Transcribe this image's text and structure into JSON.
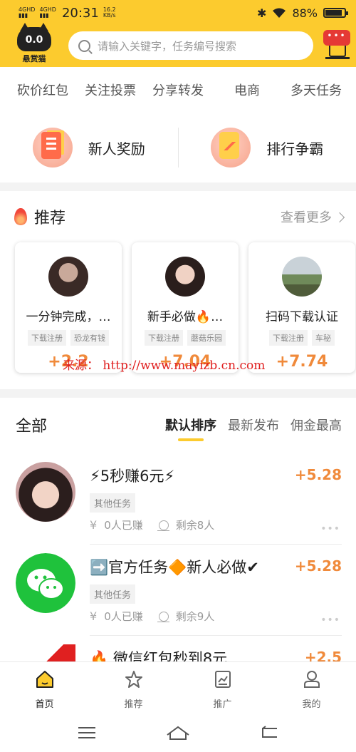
{
  "status": {
    "signal1": "4GHD",
    "signal2": "4GHD",
    "time": "20:31",
    "speed_value": "16.2",
    "speed_unit": "KB/s",
    "battery": "88%",
    "battery_level": 0.88
  },
  "header": {
    "logo_text": "悬赏猫",
    "logo_eyes": "0.0",
    "search_placeholder": "请输入关键字，任务编号搜索",
    "notif_dots": "•••"
  },
  "categories": [
    "砍价红包",
    "关注投票",
    "分享转发",
    "电商",
    "多天任务"
  ],
  "promo": [
    {
      "label": "新人奖励",
      "icon": "task-list-icon"
    },
    {
      "label": "排行争霸",
      "icon": "ranking-chart-icon"
    }
  ],
  "recommend": {
    "title": "推荐",
    "more": "查看更多",
    "cards": [
      {
        "title": "一分钟完成，…",
        "tags": [
          "下载注册",
          "恐龙有钱"
        ],
        "price": "+2.2"
      },
      {
        "title": "新手必做🔥…",
        "tags": [
          "下载注册",
          "蘑菇乐园"
        ],
        "price": "+7.04"
      },
      {
        "title": "扫码下载认证",
        "tags": [
          "下载注册",
          "车秘"
        ],
        "price": "+7.74"
      }
    ]
  },
  "watermark": "来源： http://www.mayizb.cn.com",
  "all": {
    "title": "全部",
    "sorts": [
      "默认排序",
      "最新发布",
      "佣金最高"
    ]
  },
  "tasks": [
    {
      "title": "⚡5秒赚6元⚡",
      "tag": "其他任务",
      "earned": "0人已赚",
      "remaining": "剩余8人",
      "price": "+5.28"
    },
    {
      "title": "➡️官方任务🔶新人必做✔",
      "tag": "其他任务",
      "earned": "0人已赚",
      "remaining": "剩余9人",
      "price": "+5.28"
    },
    {
      "title": "🔥 微信红包秒到8元",
      "tag": "其他任务",
      "earned": "",
      "remaining": "",
      "price": "+2.5"
    }
  ],
  "nav": [
    {
      "label": "首页",
      "icon": "home-icon"
    },
    {
      "label": "推荐",
      "icon": "star-icon"
    },
    {
      "label": "推广",
      "icon": "chart-icon"
    },
    {
      "label": "我的",
      "icon": "profile-icon"
    }
  ],
  "colors": {
    "brand": "#fccb2e",
    "price": "#f08a3b",
    "alert": "#e53935"
  }
}
